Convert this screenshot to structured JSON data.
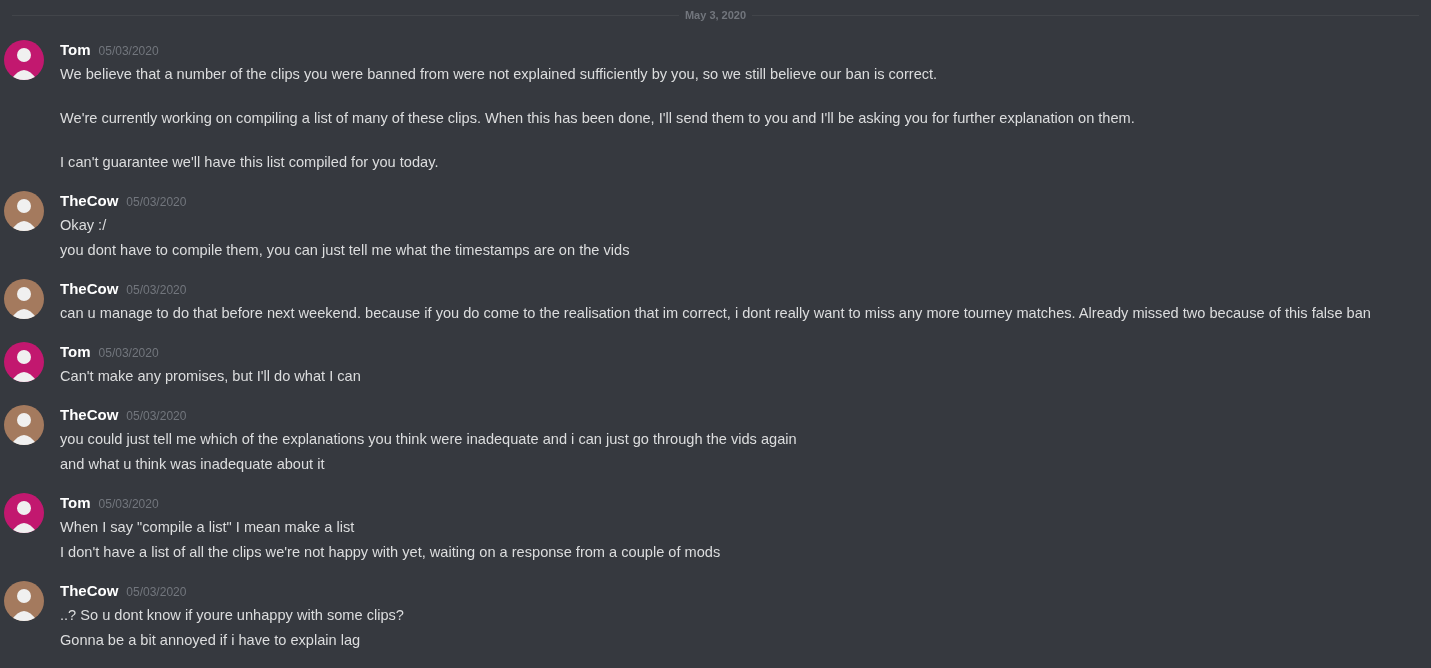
{
  "date_divider": "May 3, 2020",
  "messages": [
    {
      "author": "Tom",
      "timestamp": "05/03/2020",
      "color": "#c2186f",
      "lines": [
        [
          "We believe that a number of the clips you were banned from were not explained sufficiently by you, so we still believe our ban is correct.",
          "We're currently working on compiling a list of many of these clips. When this has been done, I'll send them to you and I'll be asking you for further explanation on them.",
          "I can't guarantee we'll have this list compiled for you today."
        ]
      ]
    },
    {
      "author": "TheCow",
      "timestamp": "05/03/2020",
      "color": "#a47a5e",
      "lines": [
        [
          "Okay :/"
        ],
        [
          "you dont have to compile them, you can just tell me what the timestamps are on the vids"
        ]
      ]
    },
    {
      "author": "TheCow",
      "timestamp": "05/03/2020",
      "color": "#a47a5e",
      "lines": [
        [
          "can u manage to do that before next weekend. because if you do come to the realisation that im correct, i dont really want to miss any more tourney matches. Already missed two because of this false ban"
        ]
      ]
    },
    {
      "author": "Tom",
      "timestamp": "05/03/2020",
      "color": "#c2186f",
      "lines": [
        [
          "Can't make any promises, but I'll do what I can"
        ]
      ]
    },
    {
      "author": "TheCow",
      "timestamp": "05/03/2020",
      "color": "#a47a5e",
      "lines": [
        [
          "you could just tell me which of the explanations you think were inadequate and i can just go through the vids again"
        ],
        [
          "and what u think was inadequate about it"
        ]
      ]
    },
    {
      "author": "Tom",
      "timestamp": "05/03/2020",
      "color": "#c2186f",
      "lines": [
        [
          "When I say \"compile a list\" I mean make a list"
        ],
        [
          "I don't have a list of all the clips we're not happy with yet, waiting on a response from a couple of mods"
        ]
      ]
    },
    {
      "author": "TheCow",
      "timestamp": "05/03/2020",
      "color": "#a47a5e",
      "lines": [
        [
          "..? So u dont know if youre unhappy with some clips?"
        ],
        [
          "Gonna be a bit annoyed if i have to explain lag"
        ]
      ]
    }
  ]
}
